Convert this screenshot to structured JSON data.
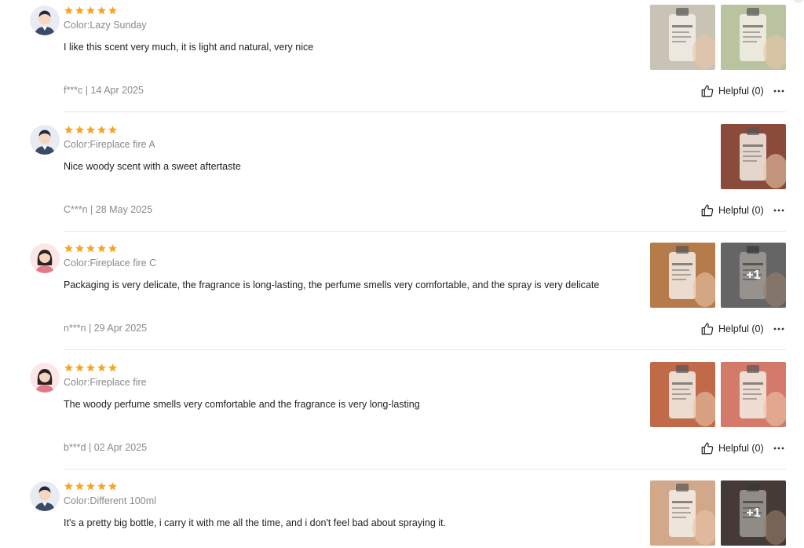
{
  "reviews": [
    {
      "avatar": "male-avatar-icon",
      "stars": 5,
      "variant": "Color:Lazy Sunday",
      "text": "I like this scent very much, it is light and natural, very nice",
      "meta": "f***c | 14 Apr 2025",
      "helpful": "Helpful (0)",
      "photos": [
        {
          "tint": "#c9c3b5",
          "label": "bottle-photo"
        },
        {
          "tint": "#b9c3a0",
          "label": "bottle-photo"
        }
      ]
    },
    {
      "avatar": "male-avatar-icon",
      "stars": 5,
      "variant": "Color:Fireplace fire A",
      "text": "Nice woody scent with a sweet aftertaste",
      "meta": "C***n | 28 May 2025",
      "helpful": "Helpful (0)",
      "photos": [
        {
          "tint": "#8a4b3a",
          "label": "bottle-photo"
        }
      ]
    },
    {
      "avatar": "female-avatar-icon",
      "stars": 5,
      "variant": "Color:Fireplace fire C",
      "text": "Packaging is very delicate, the fragrance is long-lasting, the perfume smells very comfortable, and the spray is very delicate",
      "meta": "n***n | 29 Apr 2025",
      "helpful": "Helpful (0)",
      "photos": [
        {
          "tint": "#b57b4a",
          "label": "bottle-photo"
        },
        {
          "tint": "#9b9b9b",
          "label": "bottle-photo",
          "more": "+1"
        }
      ]
    },
    {
      "avatar": "female-avatar-icon",
      "stars": 5,
      "variant": "Color:Fireplace fire",
      "text": "The woody perfume smells very comfortable and the fragrance is very long-lasting",
      "meta": "b***d | 02 Apr 2025",
      "helpful": "Helpful (0)",
      "photos": [
        {
          "tint": "#c06a4a",
          "label": "bottle-photo"
        },
        {
          "tint": "#d47a6a",
          "label": "bottle-photo"
        }
      ]
    },
    {
      "avatar": "male-avatar-icon",
      "stars": 5,
      "variant": "Color:Different 100ml",
      "text": "It's a pretty big bottle, i carry it with me all the time, and i don't feel bad about spraying it.",
      "meta": "",
      "helpful": "",
      "photos": [
        {
          "tint": "#d2a88a",
          "label": "bottle-photo"
        },
        {
          "tint": "#6b5a52",
          "label": "bottle-photo",
          "more": "+1"
        }
      ]
    }
  ],
  "colors": {
    "star": "#f5a623",
    "text": "#222222",
    "muted": "#8a8a8a",
    "divider": "#e5e5e5"
  }
}
